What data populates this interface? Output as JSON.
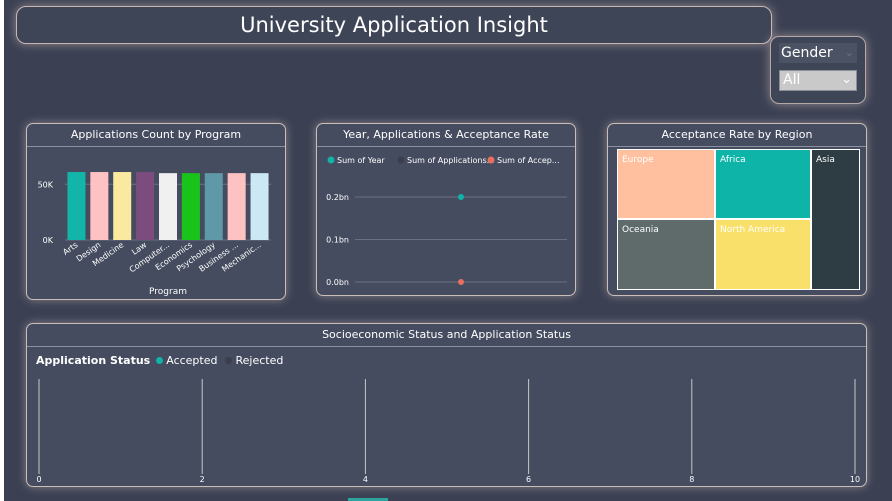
{
  "header": {
    "title": "University Application Insight"
  },
  "slicer": {
    "label": "Gender",
    "value": "All"
  },
  "colors": {
    "accepted": "#0fb4a9",
    "rejected": "#3a3f4b",
    "applications_marker": "#e76f5f"
  },
  "program_chart": {
    "title": "Applications Count by Program",
    "chart_data": {
      "type": "bar",
      "title": "Applications Count by Program",
      "xlabel": "Program",
      "ylabel": "",
      "categories": [
        "Arts",
        "Design",
        "Medicine",
        "Law",
        "Computer...",
        "Economics",
        "Psychology",
        "Business ...",
        "Mechanic..."
      ],
      "values": [
        61000,
        61000,
        61000,
        61000,
        60000,
        60000,
        60000,
        60000,
        60000
      ],
      "colors": [
        "#12b5a7",
        "#ffc2c2",
        "#fbe9a0",
        "#7c4c7e",
        "#f0f0f0",
        "#1ac31a",
        "#5f98a7",
        "#ffc2c2",
        "#cde8f5"
      ],
      "yticks": [
        "0K",
        "50K"
      ],
      "ylim": [
        0,
        70000
      ]
    }
  },
  "year_chart": {
    "title": "Year,  Applications & Acceptance Rate",
    "legend": [
      "Sum of Year",
      "Sum of Applications...",
      "Sum of Accep..."
    ],
    "chart_data": {
      "type": "scatter",
      "title": "Year,  Applications & Acceptance Rate",
      "series": [
        {
          "name": "Sum of Year",
          "values": [
            0.2
          ],
          "color": "#0fb4a9"
        },
        {
          "name": "Sum of Applications...",
          "values": [
            0.0
          ],
          "color": "#3a3f4b"
        },
        {
          "name": "Sum of Accep...",
          "values": [
            0.0
          ],
          "color": "#e76f5f"
        }
      ],
      "yticks": [
        "0.0bn",
        "0.1bn",
        "0.2bn"
      ],
      "ylim": [
        0,
        0.2
      ]
    }
  },
  "region_chart": {
    "title": "Acceptance Rate by Region",
    "chart_data": {
      "type": "treemap",
      "title": "Acceptance Rate by Region",
      "categories": [
        "Europe",
        "Africa",
        "Asia",
        "Oceania",
        "North America"
      ],
      "colors": [
        "#ffc0a0",
        "#0fb4a9",
        "#2e3d44",
        "#5f6a6b",
        "#f8e06a"
      ]
    }
  },
  "socio_chart": {
    "title": "Socioeconomic Status and Application Status",
    "legend_title": "Application Status",
    "legend": [
      "Accepted",
      "Rejected"
    ],
    "chart_data": {
      "type": "bar",
      "title": "Socioeconomic Status and Application Status",
      "series": [
        {
          "name": "Accepted",
          "values": []
        },
        {
          "name": "Rejected",
          "values": []
        }
      ],
      "xticks": [
        "0",
        "2",
        "4",
        "6",
        "8",
        "10"
      ],
      "xlim": [
        0,
        10
      ]
    }
  }
}
